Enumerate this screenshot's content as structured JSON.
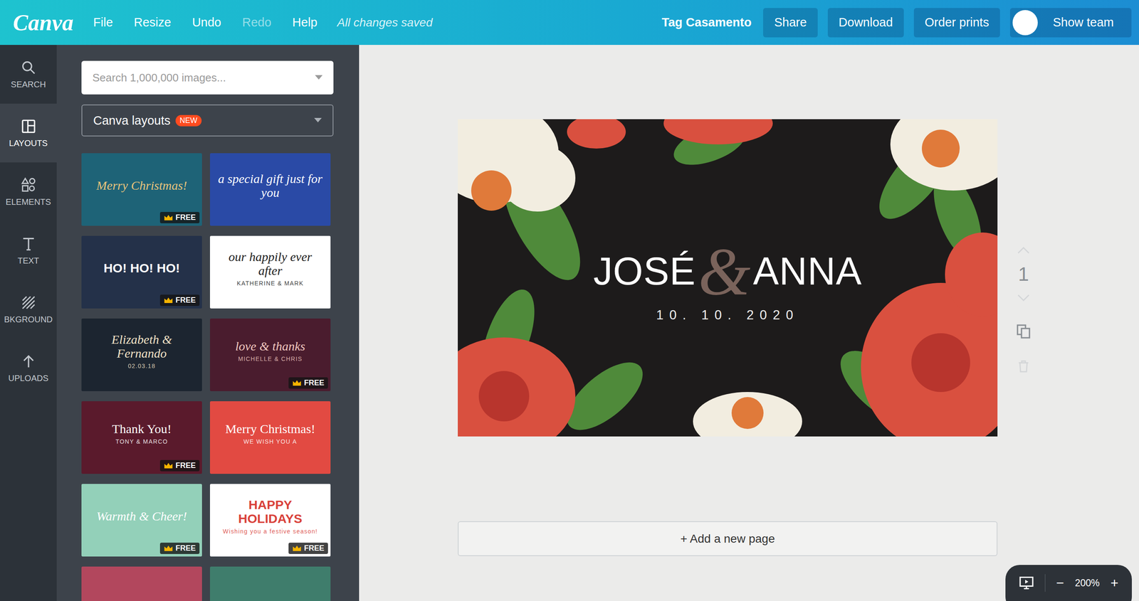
{
  "topbar": {
    "logo": "Canva",
    "menu": [
      {
        "label": "File",
        "disabled": false
      },
      {
        "label": "Resize",
        "disabled": false
      },
      {
        "label": "Undo",
        "disabled": false
      },
      {
        "label": "Redo",
        "disabled": true
      },
      {
        "label": "Help",
        "disabled": false
      }
    ],
    "save_status": "All changes saved",
    "design_title": "Tag Casamento",
    "buttons": [
      "Share",
      "Download",
      "Order prints"
    ],
    "team_button": "Show team"
  },
  "rail": [
    {
      "label": "SEARCH",
      "selected": false
    },
    {
      "label": "LAYOUTS",
      "selected": true
    },
    {
      "label": "ELEMENTS",
      "selected": false
    },
    {
      "label": "TEXT",
      "selected": false
    },
    {
      "label": "BKGROUND",
      "selected": false
    },
    {
      "label": "UPLOADS",
      "selected": false
    }
  ],
  "panel": {
    "search_placeholder": "Search 1,000,000 images...",
    "dropdown": {
      "label": "Canva layouts",
      "badge": "NEW"
    },
    "free_label": "FREE",
    "layouts": [
      {
        "title": "Merry Christmas!",
        "sub": "",
        "kind": "script",
        "free": true,
        "color": "#1e6377",
        "ink": "#e8c47c"
      },
      {
        "title": "a special gift just for you",
        "sub": "",
        "kind": "script",
        "free": false,
        "color": "#2a4aa6",
        "ink": "#ffffff"
      },
      {
        "title": "HO! HO! HO!",
        "sub": "",
        "kind": "caps",
        "free": true,
        "color": "#243149",
        "ink": "#ffffff"
      },
      {
        "title": "our happily ever after",
        "sub": "KATHERINE & MARK",
        "kind": "script",
        "free": false,
        "color": "#ffffff",
        "ink": "#222222"
      },
      {
        "title": "Elizabeth & Fernando",
        "sub": "02.03.18",
        "kind": "script",
        "free": false,
        "color": "#1c2530",
        "ink": "#f3e3c8"
      },
      {
        "title": "love & thanks",
        "sub": "MICHELLE & CHRIS",
        "kind": "script",
        "free": true,
        "color": "#4a1c2e",
        "ink": "#f1c9c0"
      },
      {
        "title": "Thank You!",
        "sub": "TONY & MARCO",
        "kind": "serif",
        "free": true,
        "color": "#5a1a2c",
        "ink": "#ffffff"
      },
      {
        "title": "Merry Christmas!",
        "sub": "WE WISH YOU A",
        "kind": "serif",
        "free": false,
        "color": "#e24a42",
        "ink": "#ffffff"
      },
      {
        "title": "Warmth & Cheer!",
        "sub": "",
        "kind": "script",
        "free": true,
        "color": "#93d0b9",
        "ink": "#ffffff"
      },
      {
        "title": "HAPPY HOLIDAYS",
        "sub": "Wishing you a festive season!",
        "kind": "caps",
        "free": true,
        "color": "#ffffff",
        "ink": "#d9413a"
      },
      {
        "title": "",
        "sub": "",
        "kind": "caps",
        "free": false,
        "color": "#b2475d",
        "ink": "#ffffff"
      },
      {
        "title": "",
        "sub": "",
        "kind": "caps",
        "free": false,
        "color": "#3f7d6c",
        "ink": "#ffffff"
      }
    ]
  },
  "design": {
    "name_left": "JOSÉ",
    "ampersand": "&",
    "name_right": "ANNA",
    "date": "10. 10. 2020"
  },
  "page_controls": {
    "page_number": "1",
    "up_disabled": true,
    "down_disabled": true,
    "delete_disabled": true
  },
  "add_page": "+ Add a new page",
  "zoom": {
    "minus": "−",
    "level": "200%",
    "plus": "+"
  }
}
